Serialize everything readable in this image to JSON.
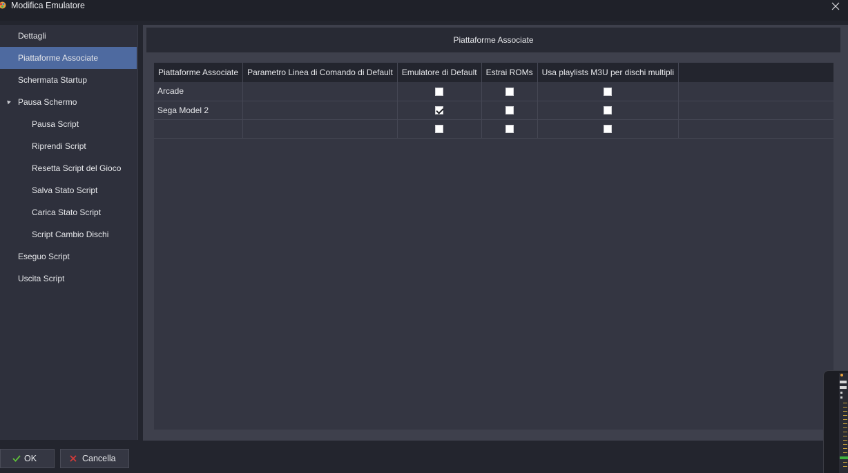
{
  "window": {
    "title": "Modifica Emulatore",
    "close_symbol": "✕"
  },
  "sidebar": {
    "items": [
      {
        "label": "Dettagli",
        "level": 0,
        "selected": false
      },
      {
        "label": "Piattaforme Associate",
        "level": 0,
        "selected": true
      },
      {
        "label": "Schermata Startup",
        "level": 0,
        "selected": false
      },
      {
        "label": "Pausa Schermo",
        "level": 0,
        "selected": false,
        "expanded": true
      },
      {
        "label": "Pausa Script",
        "level": 1,
        "selected": false
      },
      {
        "label": "Riprendi Script",
        "level": 1,
        "selected": false
      },
      {
        "label": "Resetta Script del Gioco",
        "level": 1,
        "selected": false
      },
      {
        "label": "Salva Stato Script",
        "level": 1,
        "selected": false
      },
      {
        "label": "Carica Stato Script",
        "level": 1,
        "selected": false
      },
      {
        "label": "Script Cambio Dischi",
        "level": 1,
        "selected": false
      },
      {
        "label": "Eseguo Script",
        "level": 0,
        "selected": false
      },
      {
        "label": "Uscita Script",
        "level": 0,
        "selected": false
      }
    ]
  },
  "panel": {
    "header": "Piattaforme Associate"
  },
  "grid": {
    "columns": [
      "Piattaforme Associate",
      "Parametro Linea di Comando di Default",
      "Emulatore di Default",
      "Estrai ROMs",
      "Usa playlists M3U per dischi multipli"
    ],
    "rows": [
      {
        "platform": "Arcade",
        "command_line": "",
        "default_emulator": false,
        "extract_roms": false,
        "m3u_playlists": false
      },
      {
        "platform": "Sega Model 2",
        "command_line": "",
        "default_emulator": true,
        "extract_roms": false,
        "m3u_playlists": false
      },
      {
        "platform": "",
        "command_line": "",
        "default_emulator": false,
        "extract_roms": false,
        "m3u_playlists": false
      }
    ]
  },
  "buttons": {
    "ok_label": "OK",
    "cancel_label": "Cancella"
  },
  "colors": {
    "selected_item": "#4e6aa0",
    "ok_icon": "#5fbf3a",
    "cancel_icon": "#d03a3a"
  }
}
